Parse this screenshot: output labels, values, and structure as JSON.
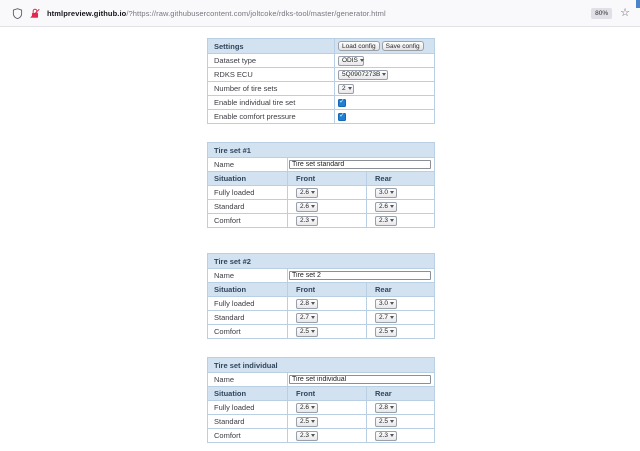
{
  "browser": {
    "url_domain": "htmlpreview.github.io",
    "url_path": "/?https://raw.githubusercontent.com/joltcoke/rdks-tool/master/generator.html",
    "zoom_badge": "80%"
  },
  "icons": {
    "check": "✓",
    "star": "☆"
  },
  "settings": {
    "title": "Settings",
    "load_button": "Load config",
    "save_button": "Save config",
    "dataset_type": {
      "label": "Dataset type",
      "value": "ODIS"
    },
    "rdks_ecu": {
      "label": "RDKS ECU",
      "value": "5Q0907273B"
    },
    "num_tire_sets": {
      "label": "Number of tire sets",
      "value": "2"
    },
    "enable_individual": {
      "label": "Enable individual tire set",
      "checked": true
    },
    "enable_comfort": {
      "label": "Enable comfort pressure",
      "checked": true
    }
  },
  "name_label": "Name",
  "table_columns": {
    "situation": "Situation",
    "front": "Front",
    "rear": "Rear"
  },
  "tire_sets": [
    {
      "title": "Tire set #1",
      "name": "Tire set standard",
      "rows": [
        {
          "situation": "Fully loaded",
          "front": "2.6",
          "rear": "3.0"
        },
        {
          "situation": "Standard",
          "front": "2.6",
          "rear": "2.6"
        },
        {
          "situation": "Comfort",
          "front": "2.3",
          "rear": "2.3"
        }
      ]
    },
    {
      "title": "Tire set #2",
      "name": "Tire set 2",
      "rows": [
        {
          "situation": "Fully loaded",
          "front": "2.8",
          "rear": "3.0"
        },
        {
          "situation": "Standard",
          "front": "2.7",
          "rear": "2.7"
        },
        {
          "situation": "Comfort",
          "front": "2.5",
          "rear": "2.5"
        }
      ]
    },
    {
      "title": "Tire set individual",
      "name": "Tire set individual",
      "rows": [
        {
          "situation": "Fully loaded",
          "front": "2.6",
          "rear": "2.8"
        },
        {
          "situation": "Standard",
          "front": "2.5",
          "rear": "2.5"
        },
        {
          "situation": "Comfort",
          "front": "2.3",
          "rear": "2.3"
        }
      ]
    }
  ],
  "colors": {
    "header_bg": "#d2e2f1",
    "table_border": "#b9cfe4",
    "checkbox_blue": "#1f7fd4",
    "insecure_lock_red": "#e22850"
  }
}
